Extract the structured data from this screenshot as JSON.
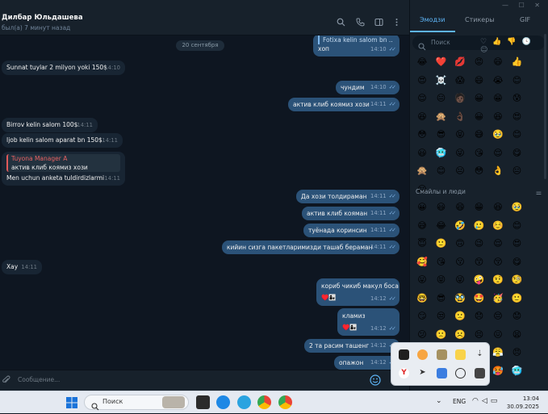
{
  "chat": {
    "name": "Дилбар Юльдашева",
    "status": "был(а) 7 минут назад",
    "date_pill": "20 сентября",
    "composer_placeholder": "Сообщение...",
    "messages": [
      {
        "dir": "out",
        "text": "Fotixa kelin salom bn ...",
        "sub": "хоп",
        "time": "14:10"
      },
      {
        "dir": "in",
        "text": "Sunnat tuylar 2 milyon yoki 150$",
        "time": "14:10"
      },
      {
        "dir": "out",
        "text": "чундим",
        "time": "14:10"
      },
      {
        "dir": "out",
        "text": "актив клиб коямиз хози",
        "time": "14:11"
      },
      {
        "dir": "in",
        "text": "Birrov kelin salom 100$",
        "time": "14:11"
      },
      {
        "dir": "in",
        "text": "Ijob kelin salom aparat bn 150$",
        "time": "14:11"
      },
      {
        "dir": "in",
        "reply_title": "Tuyona Manager A",
        "reply_text": "актив клиб коямиз хози",
        "text": "Men uchun anketa tuldirdizlarmi",
        "time": "14:11"
      },
      {
        "dir": "out",
        "text": "Да хози толдираман",
        "time": "14:11"
      },
      {
        "dir": "out",
        "text": "актив клиб кояман",
        "time": "14:11"
      },
      {
        "dir": "out",
        "text": "туёнада коринсин",
        "time": "14:11"
      },
      {
        "dir": "out",
        "text": "кийин сизга пакетларимизди ташаб бераман",
        "time": "14:11"
      },
      {
        "dir": "in",
        "text": "Xay",
        "time": "14:11"
      },
      {
        "dir": "out",
        "text": "кориб чикиб макул боса",
        "sub": "♥️👩‍👧",
        "time": "14:12"
      },
      {
        "dir": "out",
        "text": "кламиз",
        "sub": "♥️👩‍👧",
        "time": "14:12"
      },
      {
        "dir": "out",
        "text": "2 та расим ташенг",
        "time": "14:12"
      },
      {
        "dir": "out",
        "text": "опажон",
        "time": "14:12"
      }
    ]
  },
  "panel": {
    "tabs": [
      "Эмодзи",
      "Стикеры",
      "GIF"
    ],
    "search_placeholder": "Поиск",
    "section_label": "Смайлы и люди",
    "recent": [
      "😂",
      "❤️",
      "💋",
      "😡",
      "😄",
      "👍",
      "😍",
      "☠️",
      "😱",
      "😄",
      "😭",
      "😊",
      "😌",
      "😐",
      "🧑🏿",
      "😀",
      "😁",
      "😰",
      "😆",
      "🙊",
      "👌🏿",
      "😀",
      "😆",
      "😍",
      "😳",
      "😎",
      "😝",
      "😅",
      "🥹",
      "😊",
      "😃",
      "🥶",
      "😜",
      "😘",
      "😌",
      "😋",
      "🙊",
      "😊",
      "😐",
      "😳",
      "👌",
      "😐",
      "😐"
    ],
    "smileys": [
      "😀",
      "😃",
      "😄",
      "😁",
      "😆",
      "🥹",
      "😅",
      "😂",
      "🤣",
      "🥲",
      "☺️",
      "😊",
      "😇",
      "🙂",
      "🙃",
      "😉",
      "😌",
      "😍",
      "🥰",
      "😘",
      "😗",
      "😙",
      "😚",
      "😋",
      "😛",
      "😝",
      "😜",
      "🤪",
      "🤨",
      "🧐",
      "🤓",
      "😎",
      "🥸",
      "🤩",
      "🥳",
      "🙂",
      "😏",
      "😒",
      "🙁",
      "😞",
      "😔",
      "😟",
      "😕",
      "🙁",
      "☹️",
      "😣",
      "😖",
      "😫",
      "😩",
      "🥺",
      "😢",
      "😭",
      "😤",
      "😠",
      "😡",
      "🤬",
      "🤯",
      "😳",
      "🥵",
      "🥶",
      "😱",
      "😨"
    ]
  },
  "taskbar": {
    "search_placeholder": "Поиск",
    "lang": "ENG",
    "time": "13:04",
    "date": "30.09.2025"
  },
  "colors": {
    "bg": "#0e1621",
    "out_bubble": "#2b5278",
    "in_bubble": "#182533",
    "accent": "#5eb5f7"
  }
}
